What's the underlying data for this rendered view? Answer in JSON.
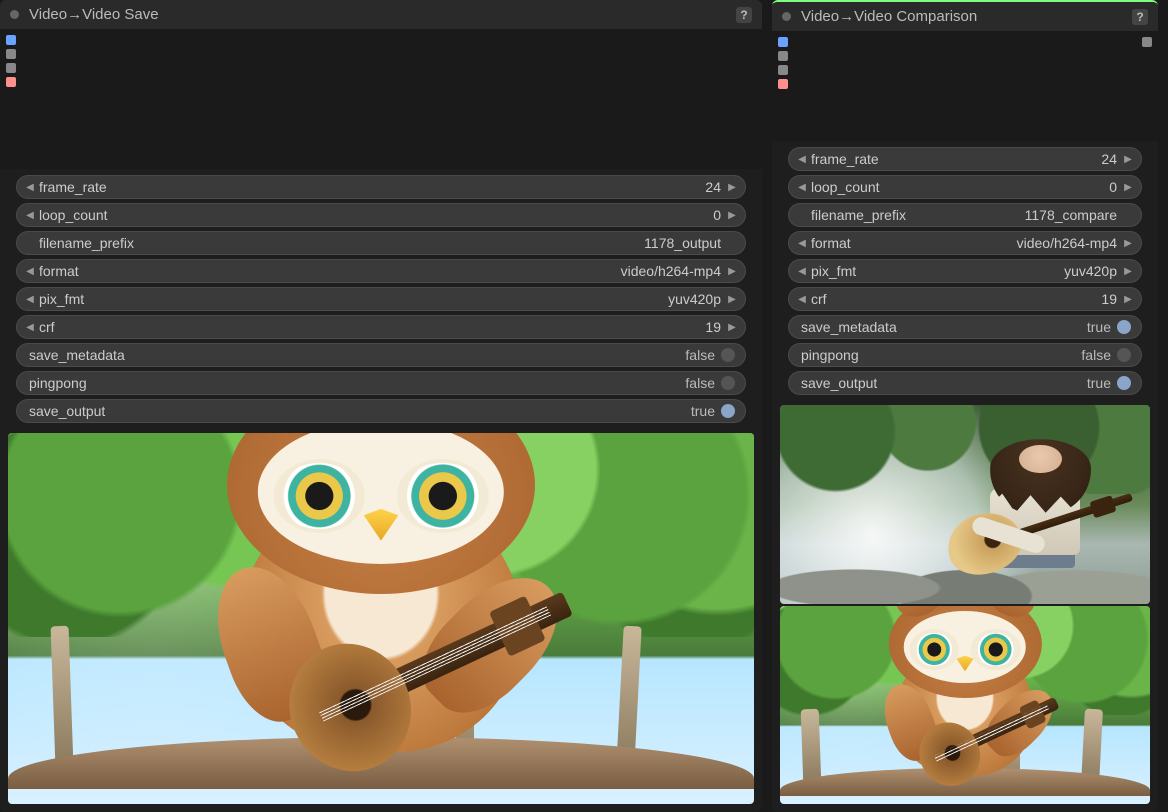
{
  "left_panel": {
    "title": "Video→Video Save",
    "ports": [
      "blue",
      "gray",
      "gray",
      "pink"
    ],
    "params": [
      {
        "kind": "stepper",
        "label": "frame_rate",
        "value": "24"
      },
      {
        "kind": "stepper",
        "label": "loop_count",
        "value": "0"
      },
      {
        "kind": "text",
        "label": "filename_prefix",
        "value": "1178_output"
      },
      {
        "kind": "stepper",
        "label": "format",
        "value": "video/h264-mp4"
      },
      {
        "kind": "stepper",
        "label": "pix_fmt",
        "value": "yuv420p"
      },
      {
        "kind": "stepper",
        "label": "crf",
        "value": "19"
      },
      {
        "kind": "toggle",
        "label": "save_metadata",
        "value": "false",
        "on": false
      },
      {
        "kind": "toggle",
        "label": "pingpong",
        "value": "false",
        "on": false
      },
      {
        "kind": "toggle",
        "label": "save_output",
        "value": "true",
        "on": true
      }
    ],
    "preview_desc": "owl-playing-guitar"
  },
  "right_panel": {
    "title": "Video→Video Comparison",
    "ports_left": [
      "blue",
      "gray",
      "gray",
      "pink"
    ],
    "ports_right": [
      "gray"
    ],
    "params": [
      {
        "kind": "stepper",
        "label": "frame_rate",
        "value": "24"
      },
      {
        "kind": "stepper",
        "label": "loop_count",
        "value": "0"
      },
      {
        "kind": "text",
        "label": "filename_prefix",
        "value": "1178_compare"
      },
      {
        "kind": "stepper",
        "label": "format",
        "value": "video/h264-mp4"
      },
      {
        "kind": "stepper",
        "label": "pix_fmt",
        "value": "yuv420p"
      },
      {
        "kind": "stepper",
        "label": "crf",
        "value": "19"
      },
      {
        "kind": "toggle",
        "label": "save_metadata",
        "value": "true",
        "on": true
      },
      {
        "kind": "toggle",
        "label": "pingpong",
        "value": "false",
        "on": false
      },
      {
        "kind": "toggle",
        "label": "save_output",
        "value": "true",
        "on": true
      }
    ],
    "preview_top_desc": "person-playing-guitar-by-waterfall",
    "preview_bottom_desc": "owl-playing-guitar"
  },
  "glyphs": {
    "help": "?",
    "tri_l": "◀",
    "tri_r": "▶"
  }
}
